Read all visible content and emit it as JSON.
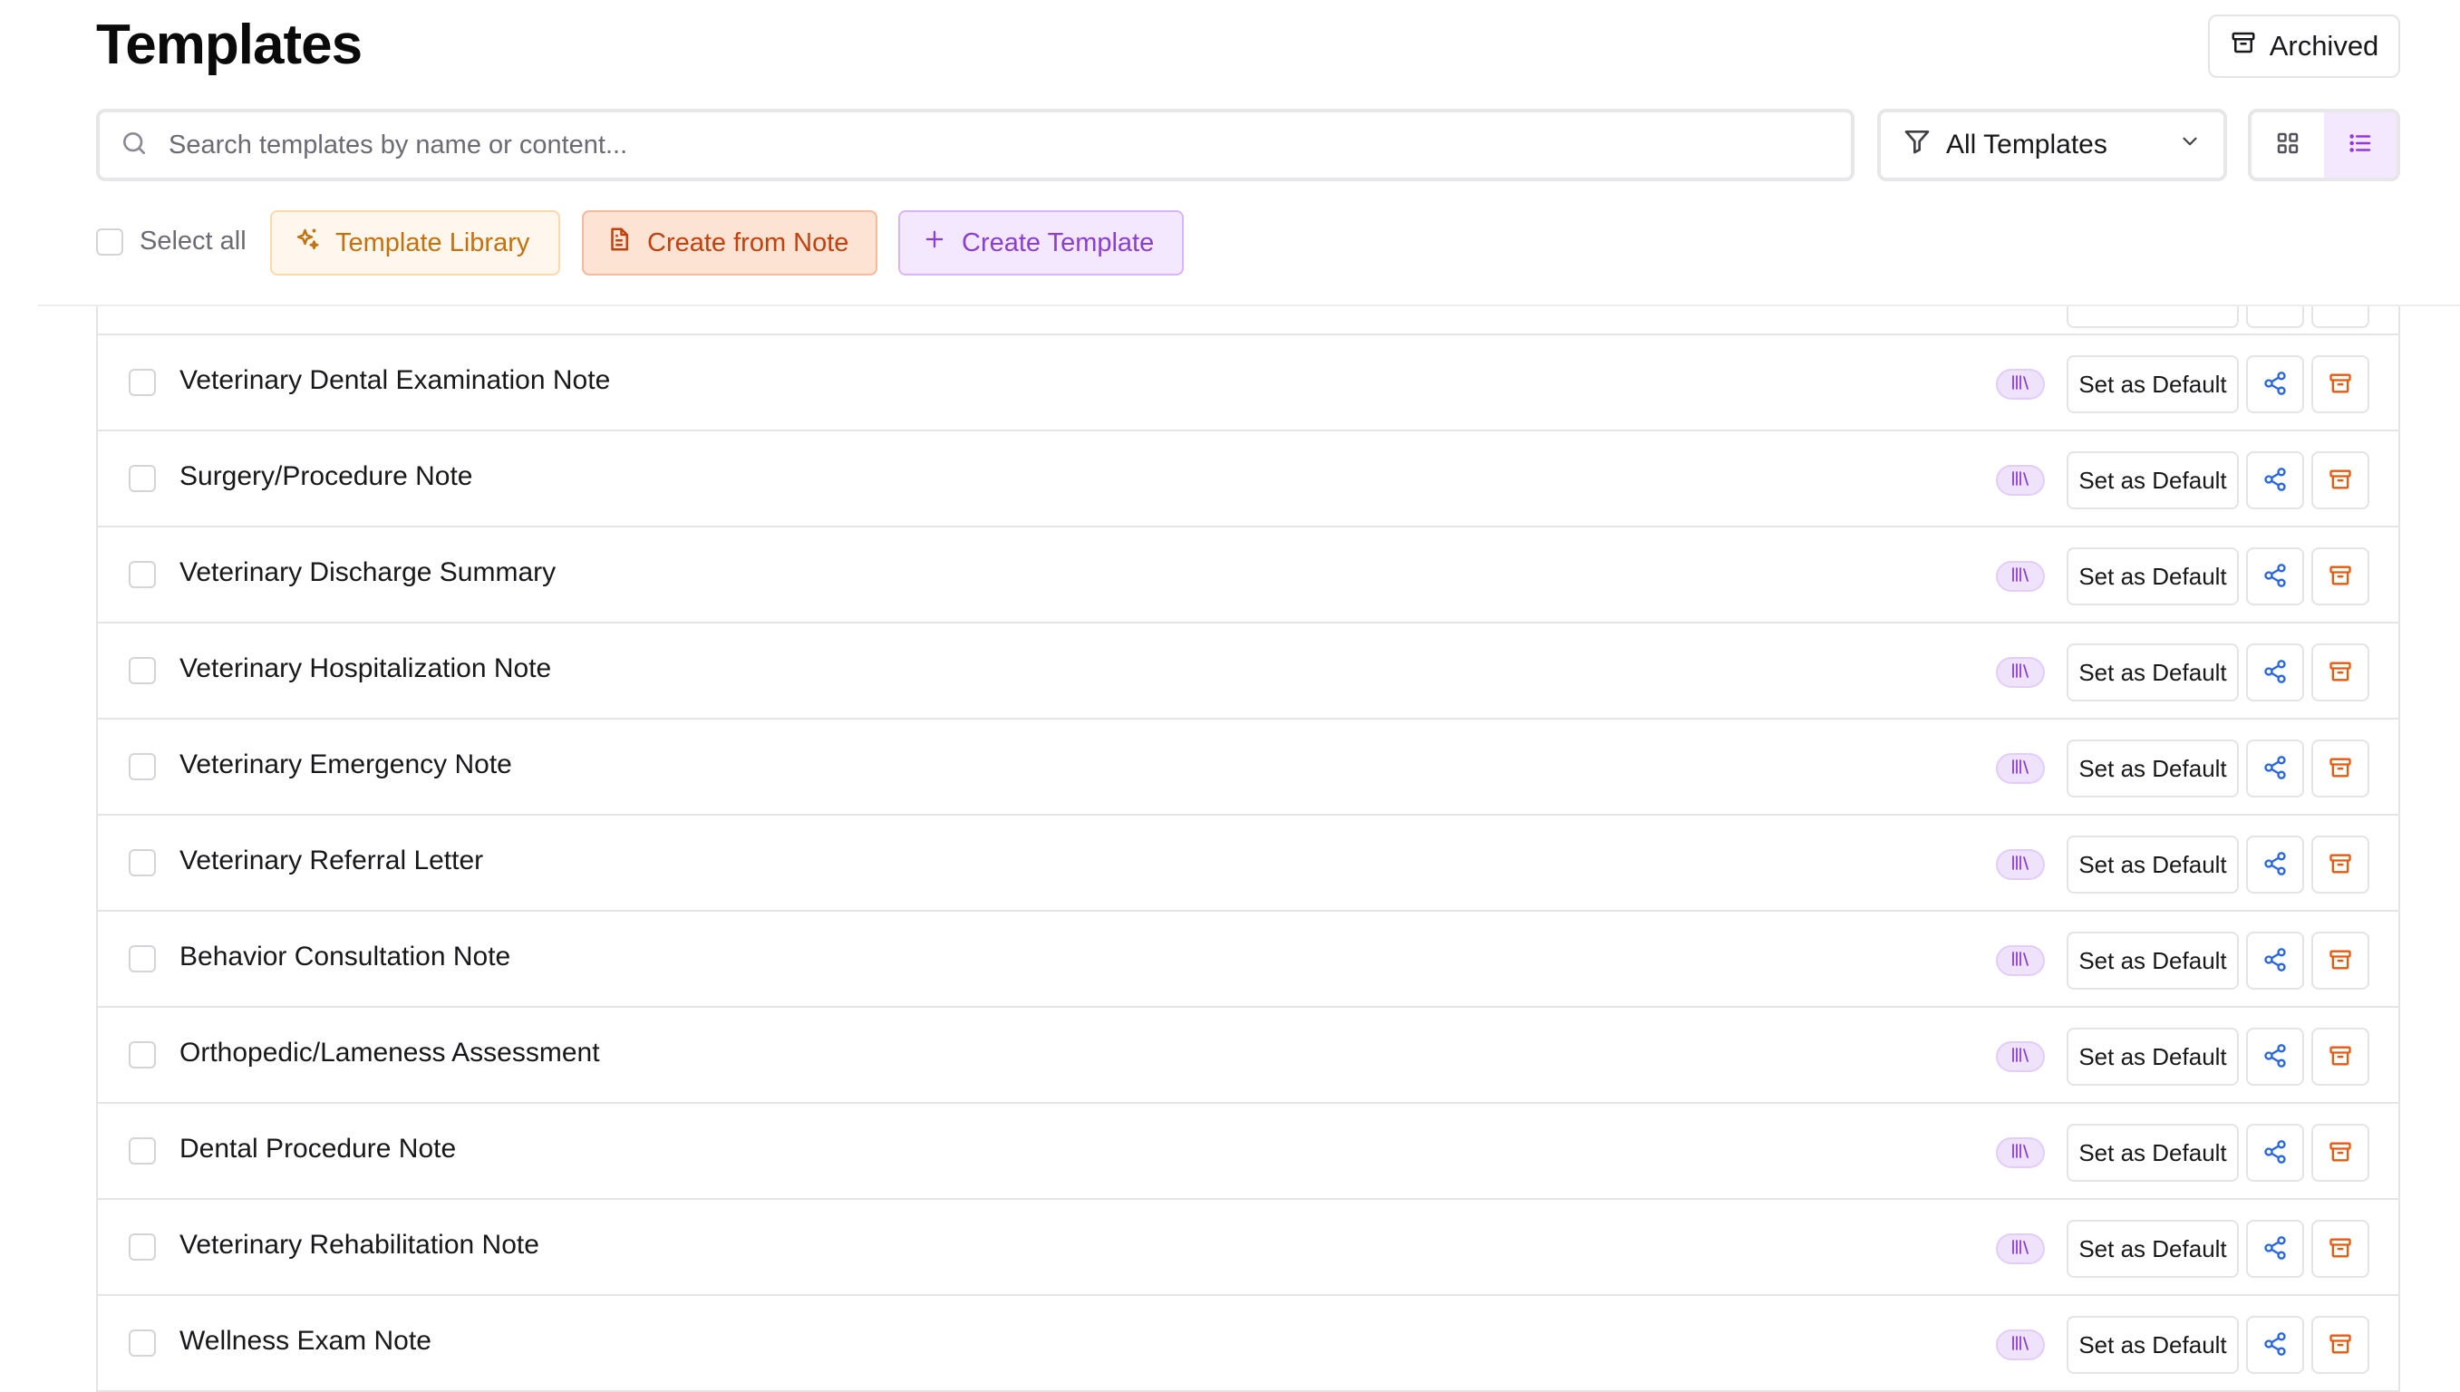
{
  "page": {
    "title": "Templates"
  },
  "header": {
    "archived_label": "Archived"
  },
  "search": {
    "placeholder": "Search templates by name or content..."
  },
  "filter": {
    "selected": "All Templates"
  },
  "actions": {
    "select_all_label": "Select all",
    "template_library_label": "Template Library",
    "create_from_note_label": "Create from Note",
    "create_template_label": "Create Template"
  },
  "row_actions": {
    "set_default_label": "Set as Default"
  },
  "templates": [
    {
      "name": "Veterinary Dental Examination Note"
    },
    {
      "name": "Surgery/Procedure Note"
    },
    {
      "name": "Veterinary Discharge Summary"
    },
    {
      "name": "Veterinary Hospitalization Note"
    },
    {
      "name": "Veterinary Emergency Note"
    },
    {
      "name": "Veterinary Referral Letter"
    },
    {
      "name": "Behavior Consultation Note"
    },
    {
      "name": "Orthopedic/Lameness Assessment"
    },
    {
      "name": "Dental Procedure Note"
    },
    {
      "name": "Veterinary Rehabilitation Note"
    },
    {
      "name": "Wellness Exam Note"
    }
  ],
  "colors": {
    "accent_purple": "#8b3fd1",
    "library_orange": "#c2720c",
    "note_orange": "#c2410c",
    "share_blue": "#2563eb",
    "archive_orange": "#ea580c"
  }
}
